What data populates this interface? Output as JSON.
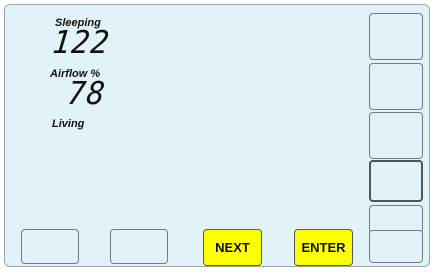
{
  "readouts": {
    "sleeping_label": "Sleeping",
    "sleeping_value": "122",
    "airflow_label": "Airflow %",
    "airflow_value": "78",
    "living_label": "Living"
  },
  "bottom_buttons": {
    "next_label": "NEXT",
    "enter_label": "ENTER"
  },
  "colors": {
    "screen_bg": "#e1f3f6",
    "action_button": "#ffff00"
  }
}
